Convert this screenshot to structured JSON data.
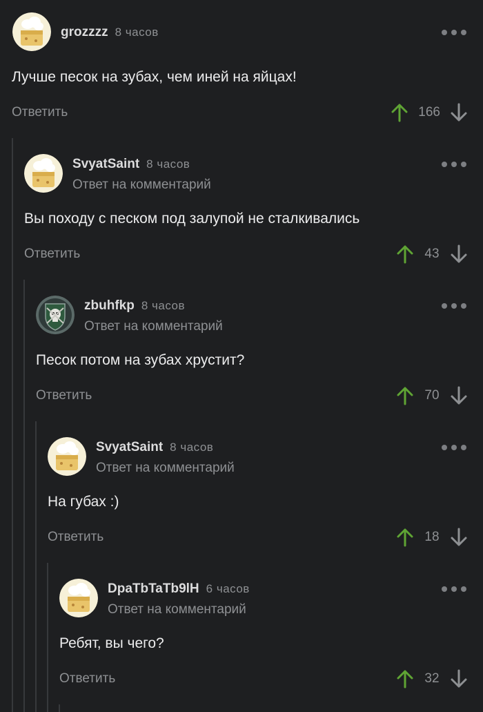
{
  "comments": [
    {
      "author": "grozzzz",
      "time": "8 часов",
      "reply_note": "",
      "text": "Лучше песок на зубах, чем иней на яйцах!",
      "reply_label": "Ответить",
      "votes": "166",
      "avatar": "chef-hat-avatar"
    },
    {
      "author": "SvyatSaint",
      "time": "8 часов",
      "reply_note": "Ответ на комментарий",
      "text": "Вы походу с песком под залупой не сталкивались",
      "reply_label": "Ответить",
      "votes": "43",
      "avatar": "chef-hat-avatar"
    },
    {
      "author": "zbuhfkp",
      "time": "8 часов",
      "reply_note": "Ответ на комментарий",
      "text": "Песок потом на зубах хрустит?",
      "reply_label": "Ответить",
      "votes": "70",
      "avatar": "skull-shield-avatar"
    },
    {
      "author": "SvyatSaint",
      "time": "8 часов",
      "reply_note": "Ответ на комментарий",
      "text": "На губах :)",
      "reply_label": "Ответить",
      "votes": "18",
      "avatar": "chef-hat-avatar"
    },
    {
      "author": "DpaTbTaTb9lH",
      "time": "6 часов",
      "reply_note": "Ответ на комментарий",
      "text": "Ребят, вы чего?",
      "reply_label": "Ответить",
      "votes": "32",
      "avatar": "chef-hat-avatar"
    }
  ],
  "colors": {
    "background": "#1e1f21",
    "upvote": "#5fa434",
    "muted": "#8e9093"
  }
}
